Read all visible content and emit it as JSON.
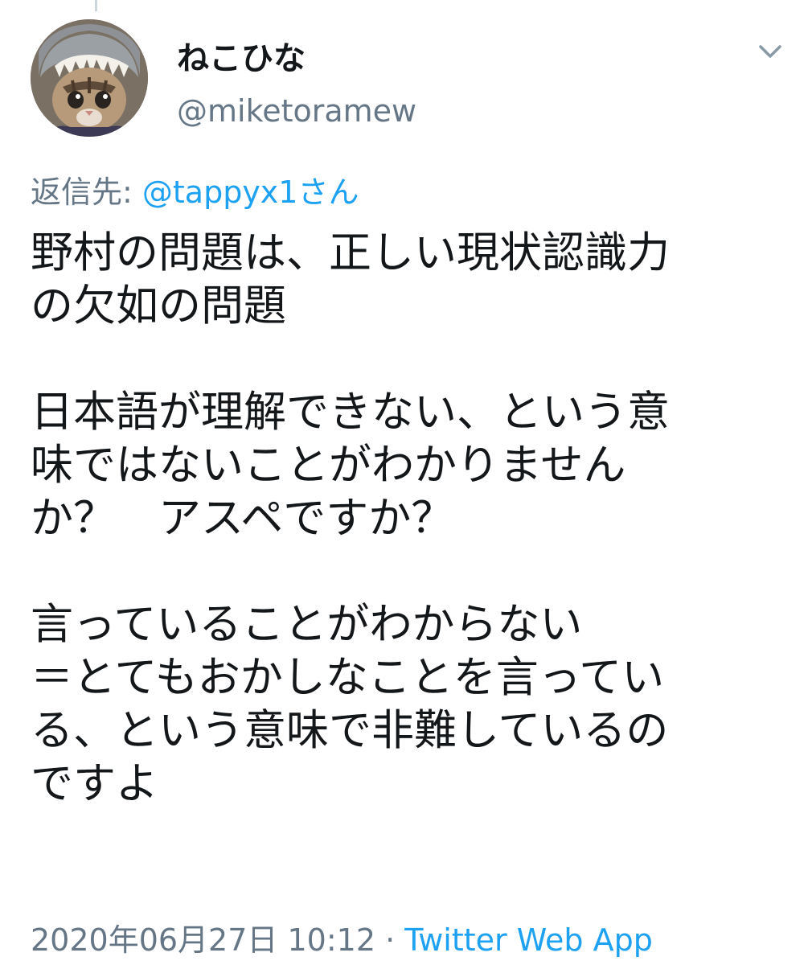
{
  "tweet": {
    "display_name": "ねこひな",
    "handle": "@miketoramew",
    "reply_to_prefix": "返信先: ",
    "reply_to_mention": "@tappyx1さん",
    "text_lines": [
      "野村の問題は、正しい現状認識力",
      "の欠如の問題",
      "日本語が理解できない、という意",
      "味ではないことがわかりません",
      "か？　アスペですか？",
      "言っていることがわからない",
      "＝とてもおかしなことを言ってい",
      "る、という意味で非難しているの",
      "ですよ"
    ],
    "timestamp": "2020年06月27日 10:12",
    "separator": " · ",
    "source": "Twitter Web App"
  },
  "icons": {
    "avatar": "cat-in-shark-hood-avatar",
    "menu": "chevron-down-icon"
  },
  "colors": {
    "text": "#14171a",
    "secondary": "#657786",
    "link": "#1da1f2",
    "thread_line": "#ccd6dd"
  }
}
